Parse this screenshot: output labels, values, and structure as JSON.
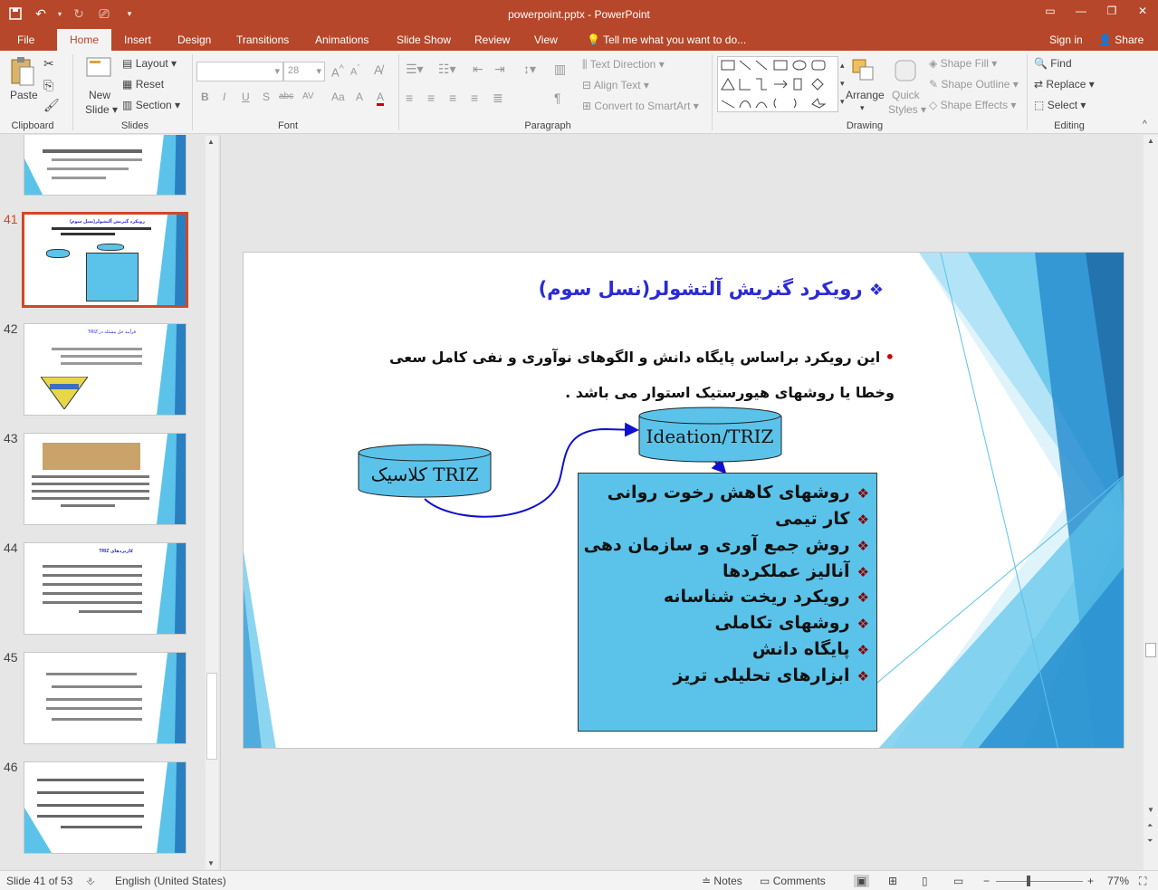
{
  "window": {
    "title": "powerpoint.pptx - PowerPoint",
    "controls": [
      "restore-ribbon",
      "minimize",
      "maximize",
      "close"
    ]
  },
  "tabs": [
    "File",
    "Home",
    "Insert",
    "Design",
    "Transitions",
    "Animations",
    "Slide Show",
    "Review",
    "View"
  ],
  "tell_me": "Tell me what you want to do...",
  "sign_in": "Sign in",
  "share": "Share",
  "ribbon": {
    "clipboard": {
      "label": "Clipboard",
      "paste": "Paste"
    },
    "slides": {
      "label": "Slides",
      "new_slide_1": "New",
      "new_slide_2": "Slide",
      "layout": "Layout",
      "reset": "Reset",
      "section": "Section"
    },
    "font": {
      "label": "Font",
      "size": "28",
      "buttons": [
        "B",
        "I",
        "U",
        "S",
        "abc",
        "AV",
        "Aa",
        "A",
        "A"
      ]
    },
    "paragraph": {
      "label": "Paragraph",
      "text_direction": "Text Direction",
      "align_text": "Align Text",
      "convert": "Convert to SmartArt"
    },
    "drawing": {
      "label": "Drawing",
      "arrange": "Arrange",
      "quick_styles_1": "Quick",
      "quick_styles_2": "Styles",
      "shape_fill": "Shape Fill",
      "shape_outline": "Shape Outline",
      "shape_effects": "Shape Effects"
    },
    "editing": {
      "label": "Editing",
      "find": "Find",
      "replace": "Replace",
      "select": "Select"
    }
  },
  "thumbnails": [
    {
      "num": "",
      "title": "",
      "selected": false
    },
    {
      "num": "41",
      "title": "رویکرد گنریش آلتشولر(نسل سوم)",
      "selected": true
    },
    {
      "num": "42",
      "title": "فرآیند حل مسئله در TRIZ",
      "selected": false
    },
    {
      "num": "43",
      "title": "",
      "selected": false
    },
    {
      "num": "44",
      "title": "کاربردهای TRIZ",
      "selected": false
    },
    {
      "num": "45",
      "title": "",
      "selected": false
    },
    {
      "num": "46",
      "title": "",
      "selected": false
    }
  ],
  "slide": {
    "title": "رویکرد گنریش آلتشولر(نسل سوم)",
    "body": "این رویکرد براساس پایگاه دانش و الگوهای نوآوری و نفی کامل سعی وخطا یا روشهای هیورستیک استوار می باشد .",
    "cyl_left": "TRIZ کلاسیک",
    "cyl_right": "Ideation/TRIZ",
    "items": [
      "روشهای کاهش رخوت روانی",
      "کار تیمی",
      "روش جمع آوری و سازمان دهی",
      "آنالیز عملکردها",
      "رویکرد ریخت شناسانه",
      "روشهای تکاملی",
      "پایگاه دانش",
      "ابزارهای تحلیلی تریز"
    ]
  },
  "status": {
    "slide_of": "Slide 41 of 53",
    "language": "English (United States)",
    "notes": "Notes",
    "comments": "Comments",
    "zoom": "77%"
  },
  "colors": {
    "accent": "#b7472a",
    "slide_title": "#2b2bd4",
    "box_fill": "#5bc3ea",
    "bullet": "#8b0000"
  }
}
